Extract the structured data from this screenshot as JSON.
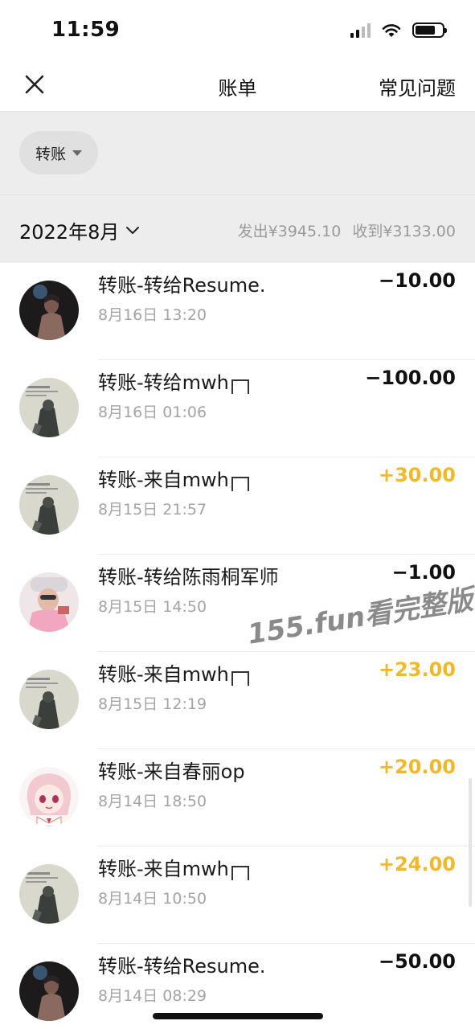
{
  "status_bar": {
    "time": "11:59",
    "battery_level": 0.75,
    "signal_bars": 4,
    "signal_active": 2
  },
  "nav": {
    "title": "账单",
    "faq": "常见问题",
    "close_icon": "close-icon"
  },
  "filter": {
    "chip_label": "转账"
  },
  "month": {
    "label": "2022年8月",
    "sent": "发出¥3945.10",
    "received": "收到¥3133.00"
  },
  "transactions": [
    {
      "title": "转账-转给Resume.",
      "has_box": false,
      "time": "8月16日 13:20",
      "amount": "−10.00",
      "type": "expense",
      "avatar": "dark-figure"
    },
    {
      "title": "转账-转给mwh",
      "has_box": true,
      "time": "8月16日 01:06",
      "amount": "−100.00",
      "type": "expense",
      "avatar": "sketch-poster"
    },
    {
      "title": "转账-来自mwh",
      "has_box": true,
      "time": "8月15日 21:57",
      "amount": "+30.00",
      "type": "income",
      "avatar": "sketch-poster"
    },
    {
      "title": "转账-转给陈雨桐军师",
      "has_box": false,
      "time": "8月15日 14:50",
      "amount": "−1.00",
      "type": "expense",
      "avatar": "pink-person"
    },
    {
      "title": "转账-来自mwh",
      "has_box": true,
      "time": "8月15日 12:19",
      "amount": "+23.00",
      "type": "income",
      "avatar": "sketch-poster"
    },
    {
      "title": "转账-来自春丽op",
      "has_box": false,
      "time": "8月14日 18:50",
      "amount": "+20.00",
      "type": "income",
      "avatar": "anime-girl"
    },
    {
      "title": "转账-来自mwh",
      "has_box": true,
      "time": "8月14日 10:50",
      "amount": "+24.00",
      "type": "income",
      "avatar": "sketch-poster"
    },
    {
      "title": "转账-转给Resume.",
      "has_box": false,
      "time": "8月14日 08:29",
      "amount": "−50.00",
      "type": "expense",
      "avatar": "dark-figure"
    }
  ],
  "watermark": "155.fun看完整版",
  "colors": {
    "income": "#f0b92a",
    "expense": "#111111",
    "header_bg": "#ededed"
  }
}
